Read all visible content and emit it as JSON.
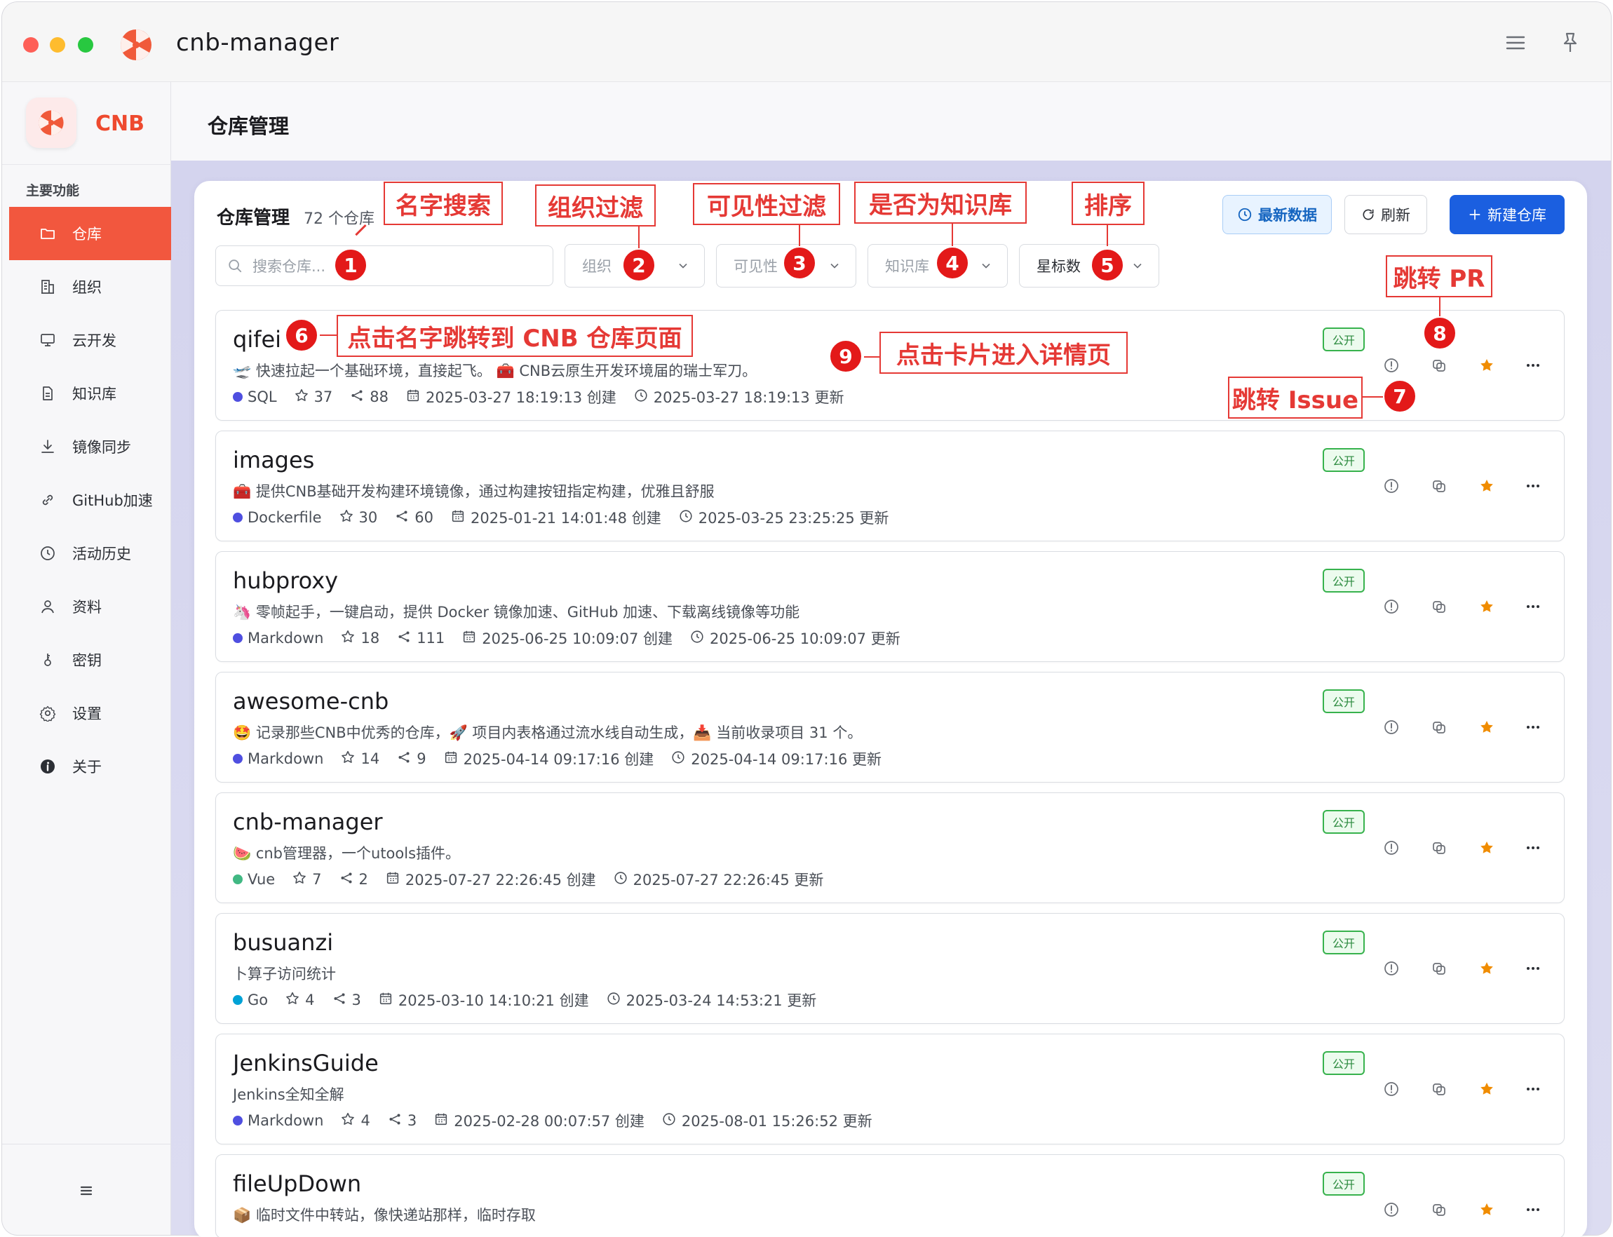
{
  "window": {
    "title": "cnb-manager"
  },
  "sidebar": {
    "brand": "CNB",
    "section": "主要功能",
    "items": [
      {
        "label": "仓库",
        "icon": "folder-icon",
        "active": true
      },
      {
        "label": "组织",
        "icon": "building-icon"
      },
      {
        "label": "云开发",
        "icon": "monitor-icon"
      },
      {
        "label": "知识库",
        "icon": "document-icon"
      },
      {
        "label": "镜像同步",
        "icon": "download-icon"
      },
      {
        "label": "GitHub加速",
        "icon": "link-icon"
      },
      {
        "label": "活动历史",
        "icon": "clock-icon"
      },
      {
        "label": "资料",
        "icon": "user-icon"
      },
      {
        "label": "密钥",
        "icon": "key-icon"
      },
      {
        "label": "设置",
        "icon": "gear-icon"
      },
      {
        "label": "关于",
        "icon": "info-icon"
      }
    ]
  },
  "header": {
    "title": "仓库管理"
  },
  "panel": {
    "title": "仓库管理",
    "count": "72 个仓库",
    "btn_latest": "最新数据",
    "btn_refresh": "刷新",
    "btn_new": "新建仓库",
    "search_placeholder": "搜索仓库...",
    "filter_org": "组织",
    "filter_visibility": "可见性",
    "filter_kb": "知识库",
    "sort": "星标数"
  },
  "repos": [
    {
      "name": "qifei",
      "desc": "🛫 快速拉起一个基础环境，直接起飞。 🧰 CNB云原生开发环境届的瑞士军刀。",
      "lang": "SQL",
      "lang_color": "#4f4fe0",
      "stars": "37",
      "forks": "88",
      "created": "2025-03-27 18:19:13 创建",
      "updated": "2025-03-27 18:19:13 更新",
      "badge": "公开"
    },
    {
      "name": "images",
      "desc": "🧰 提供CNB基础开发构建环境镜像，通过构建按钮指定构建，优雅且舒服",
      "lang": "Dockerfile",
      "lang_color": "#4f4fe0",
      "stars": "30",
      "forks": "60",
      "created": "2025-01-21 14:01:48 创建",
      "updated": "2025-03-25 23:25:25 更新",
      "badge": "公开"
    },
    {
      "name": "hubproxy",
      "desc": "🦄 零帧起手，一键启动，提供 Docker 镜像加速、GitHub 加速、下载离线镜像等功能",
      "lang": "Markdown",
      "lang_color": "#4f4fe0",
      "stars": "18",
      "forks": "111",
      "created": "2025-06-25 10:09:07 创建",
      "updated": "2025-06-25 10:09:07 更新",
      "badge": "公开"
    },
    {
      "name": "awesome-cnb",
      "desc": "🤩 记录那些CNB中优秀的仓库，🚀 项目内表格通过流水线自动生成，📥 当前收录项目 31 个。",
      "lang": "Markdown",
      "lang_color": "#4f4fe0",
      "stars": "14",
      "forks": "9",
      "created": "2025-04-14 09:17:16 创建",
      "updated": "2025-04-14 09:17:16 更新",
      "badge": "公开"
    },
    {
      "name": "cnb-manager",
      "desc": "🍉 cnb管理器，一个utools插件。",
      "lang": "Vue",
      "lang_color": "#41b883",
      "stars": "7",
      "forks": "2",
      "created": "2025-07-27 22:26:45 创建",
      "updated": "2025-07-27 22:26:45 更新",
      "badge": "公开"
    },
    {
      "name": "busuanzi",
      "desc": "卜算子访问统计",
      "lang": "Go",
      "lang_color": "#00a2d6",
      "stars": "4",
      "forks": "3",
      "created": "2025-03-10 14:10:21 创建",
      "updated": "2025-03-24 14:53:21 更新",
      "badge": "公开"
    },
    {
      "name": "JenkinsGuide",
      "desc": "Jenkins全知全解",
      "lang": "Markdown",
      "lang_color": "#4f4fe0",
      "stars": "4",
      "forks": "3",
      "created": "2025-02-28 00:07:57 创建",
      "updated": "2025-08-01 15:26:52 更新",
      "badge": "公开"
    },
    {
      "name": "fileUpDown",
      "desc": "📦 临时文件中转站，像快递站那样，临时存取",
      "lang": "",
      "lang_color": "#4f4fe0",
      "stars": "",
      "forks": "",
      "created": "",
      "updated": "",
      "badge": "公开"
    }
  ],
  "annotations": [
    {
      "num": "1",
      "text": "名字搜索"
    },
    {
      "num": "2",
      "text": "组织过滤"
    },
    {
      "num": "3",
      "text": "可见性过滤"
    },
    {
      "num": "4",
      "text": "是否为知识库"
    },
    {
      "num": "5",
      "text": "排序"
    },
    {
      "num": "6",
      "text": "点击名字跳转到 CNB 仓库页面"
    },
    {
      "num": "7",
      "text": "跳转 Issue"
    },
    {
      "num": "8",
      "text": "跳转 PR"
    },
    {
      "num": "9",
      "text": "点击卡片进入详情页"
    }
  ],
  "colors": {
    "accent": "#f2573e",
    "primary": "#1b5fe0",
    "badge_green": "#37b24d",
    "star": "#f08c00",
    "annotation": "#e53935"
  }
}
